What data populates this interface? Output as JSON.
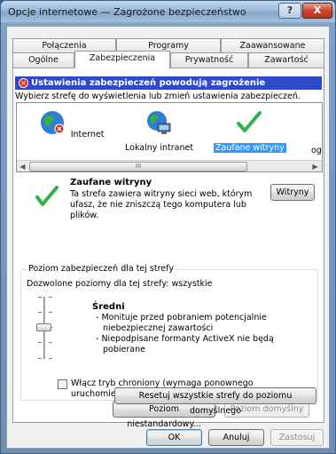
{
  "window": {
    "title": "Opcje internetowe — Zagrożone bezpieczeństwo",
    "help": "?",
    "close": "X"
  },
  "tabs": {
    "row1": [
      "Połączenia",
      "Programy",
      "Zaawansowane"
    ],
    "row2": [
      "Ogólne",
      "Zabezpieczenia",
      "Prywatność",
      "Zawartość"
    ],
    "active": "Zabezpieczenia"
  },
  "security": {
    "warning": "Ustawienia zabezpieczeń powodują zagrożenie komputera.",
    "choose_zone": "Wybierz strefę do wyświetlenia lub zmień ustawienia zabezpieczeń.",
    "zones": [
      {
        "label": "Internet",
        "icon": "globe-icon"
      },
      {
        "label": "Lokalny intranet",
        "icon": "intranet-icon"
      },
      {
        "label": "Zaufane witryny",
        "icon": "checkmark-icon",
        "selected": true
      }
    ],
    "zones_cutoff": "og",
    "scroll_grip": "III",
    "zone_title": "Zaufane witryny",
    "zone_description": "Ta strefa zawiera witryny sieci web, którym ufasz, że nie zniszczą tego komputera lub plików.",
    "sites_button": "Witryny",
    "level_group": {
      "legend": "Poziom zabezpieczeń dla tej strefy",
      "allowed": "Dozwolone poziomy dla tej strefy: wszystkie",
      "level": "Średni",
      "bullets": [
        "- Monituje przed pobraniem potencjalnie niebezpiecznej zawartości",
        "- Niepodpisane formanty ActiveX nie będą pobierane"
      ],
      "protected_mode": "Włącz tryb chroniony (wymaga ponownego uruchomienia programu Internet Explorer)",
      "custom_level": "Poziom niestandardowy...",
      "default_level": "Poziom domyślny"
    },
    "reset_all": "Resetuj wszystkie strefy do poziomu domyślnego"
  },
  "footer": {
    "ok": "OK",
    "cancel": "Anuluj",
    "apply": "Zastosuj"
  },
  "colors": {
    "warning_bar": "#2f49c9",
    "selection": "#3399ff",
    "check_green": "#2fb24a"
  }
}
